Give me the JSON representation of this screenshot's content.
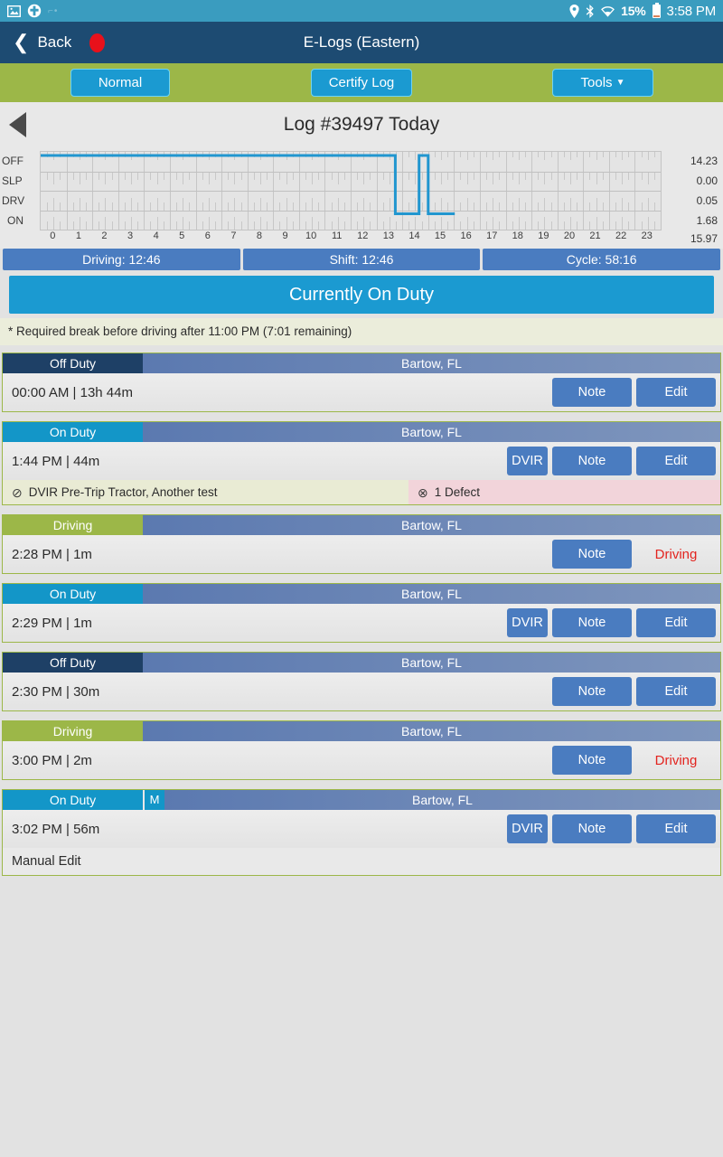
{
  "statusbar": {
    "left_icons": [
      "image-icon",
      "medical-cross-icon",
      "faded-icon"
    ],
    "faded_label": "⌐•",
    "location_icon": "location-pin-icon",
    "bluetooth_icon": "bluetooth-icon",
    "wifi_icon": "wifi-icon",
    "battery_percent": "15%",
    "time": "3:58 PM"
  },
  "navbar": {
    "back_label": "Back",
    "title": "E-Logs (Eastern)",
    "recording_indicator": "red-dot"
  },
  "toolbar": {
    "normal_label": "Normal",
    "certify_label": "Certify Log",
    "tools_label": "Tools"
  },
  "log": {
    "prev_arrow": "previous-day-arrow",
    "title": "Log #39497 Today"
  },
  "chart_data": {
    "type": "line",
    "title": "Log #39497 Today",
    "xlabel": "",
    "ylabel": "",
    "x": [
      0,
      1,
      2,
      3,
      4,
      5,
      6,
      7,
      8,
      9,
      10,
      11,
      12,
      13,
      14,
      15,
      16,
      17,
      18,
      19,
      20,
      21,
      22,
      23
    ],
    "xtick_labels": [
      "0",
      "1",
      "2",
      "3",
      "4",
      "5",
      "6",
      "7",
      "8",
      "9",
      "10",
      "11",
      "12",
      "13",
      "14",
      "15",
      "16",
      "17",
      "18",
      "19",
      "20",
      "21",
      "22",
      "23"
    ],
    "xlim": [
      0,
      24
    ],
    "status_rows": [
      "OFF",
      "SLP",
      "DRV",
      "ON"
    ],
    "totals": [
      "14.23",
      "0.00",
      "0.05",
      "1.68"
    ],
    "grand_total": "15.97",
    "line_color": "#2196cf",
    "grid": true,
    "segments": [
      {
        "status": "OFF",
        "start": 0.0,
        "end": 13.73
      },
      {
        "status": "ON",
        "start": 13.73,
        "end": 14.65
      },
      {
        "status": "OFF",
        "start": 14.65,
        "end": 15.0
      },
      {
        "status": "ON",
        "start": 15.0,
        "end": 16.03
      }
    ]
  },
  "summary": {
    "driving": "Driving: 12:46",
    "shift": "Shift: 12:46",
    "cycle": "Cycle: 58:16"
  },
  "current_status": "Currently On Duty",
  "break_note": "* Required break before driving after 11:00 PM (7:01 remaining)",
  "entries": [
    {
      "duty": "Off Duty",
      "duty_type": "off",
      "location": "Bartow,  FL",
      "time": "00:00 AM | 13h 44m",
      "buttons": [
        "Note",
        "Edit"
      ],
      "manual": false
    },
    {
      "duty": "On Duty",
      "duty_type": "on",
      "location": "Bartow,  FL",
      "time": "1:44 PM | 44m",
      "buttons": [
        "DVIR",
        "Note",
        "Edit"
      ],
      "dvir_text": "DVIR Pre-Trip Tractor, Another test",
      "defect_text": "1 Defect",
      "manual": false
    },
    {
      "duty": "Driving",
      "duty_type": "drv",
      "location": "Bartow,  FL",
      "time": "2:28 PM | 1m",
      "buttons": [
        "Note"
      ],
      "driving_label": "Driving",
      "manual": false
    },
    {
      "duty": "On Duty",
      "duty_type": "on",
      "location": "Bartow,  FL",
      "time": "2:29 PM | 1m",
      "buttons": [
        "DVIR",
        "Note",
        "Edit"
      ],
      "manual": false
    },
    {
      "duty": "Off Duty",
      "duty_type": "off",
      "location": "Bartow,  FL",
      "time": "2:30 PM | 30m",
      "buttons": [
        "Note",
        "Edit"
      ],
      "manual": false
    },
    {
      "duty": "Driving",
      "duty_type": "drv",
      "location": "Bartow,  FL",
      "time": "3:00 PM | 2m",
      "buttons": [
        "Note"
      ],
      "driving_label": "Driving",
      "manual": false
    },
    {
      "duty": "On Duty",
      "duty_type": "on",
      "location": "Bartow,  FL",
      "time": "3:02 PM | 56m",
      "buttons": [
        "DVIR",
        "Note",
        "Edit"
      ],
      "manual": true,
      "manual_badge": "M",
      "manual_text": "Manual Edit"
    }
  ],
  "colors": {
    "accent_blue": "#1b9ad1",
    "green_band": "#9cb748",
    "navy": "#1d4b72",
    "button_blue": "#4a7cc0",
    "driving_red": "#e3241f"
  }
}
